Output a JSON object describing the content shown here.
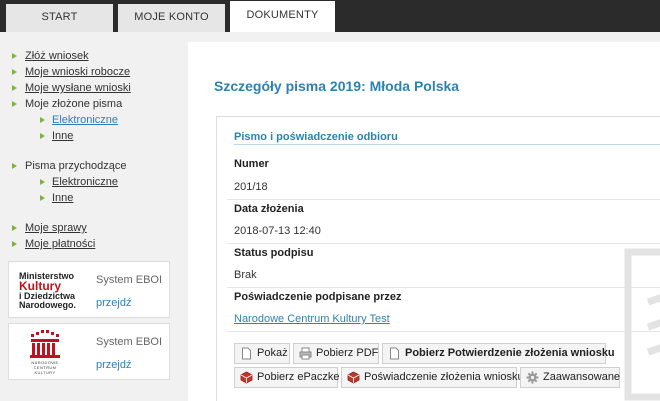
{
  "tabs": [
    "START",
    "MOJE KONTO",
    "DOKUMENTY"
  ],
  "sidebar": {
    "items": [
      "Złóż wniosek",
      "Moje wnioski robocze",
      "Moje wysłane wnioski"
    ],
    "section1": {
      "label": "Moje złożone pisma",
      "subs": [
        "Elektroniczne",
        "Inne"
      ]
    },
    "section2": {
      "label": "Pisma przychodzące",
      "subs": [
        "Elektroniczne",
        "Inne"
      ]
    },
    "bottom": [
      "Moje sprawy",
      "Moje płatności"
    ]
  },
  "promos": [
    {
      "logo": [
        "Ministerstwo",
        "Kultury",
        "i Dziedzictwa",
        "Narodowego."
      ],
      "system": "System EBOI",
      "link": "przejdź"
    },
    {
      "logo": [
        "NARODOWE",
        "CENTRUM",
        "KULTURY"
      ],
      "system": "System EBOI",
      "link": "przejdź"
    }
  ],
  "main": {
    "title": "Szczegóły pisma 2019: Młoda Polska",
    "panel_title": "Pismo i poświadczenie odbioru",
    "fields": [
      {
        "label": "Numer",
        "value": "201/18"
      },
      {
        "label": "Data złożenia",
        "value": "2018-07-13 12:40"
      },
      {
        "label": "Status podpisu",
        "value": "Brak"
      },
      {
        "label": "Poświadczenie podpisane przez",
        "value": "Narodowe Centrum Kultury Test"
      }
    ],
    "buttons": [
      "Pokaż",
      "Pobierz PDF",
      "Pobierz Potwierdzenie złożenia wniosku",
      "Pobierz ePaczke",
      "Poświadczenie złożenia wniosku",
      "Zaawansowane"
    ]
  },
  "colors": {
    "accent": "#2b83b0",
    "nav_arrow": "#7fb33c",
    "topbar": "#2b2b2b",
    "brand_red": "#c0121c"
  }
}
